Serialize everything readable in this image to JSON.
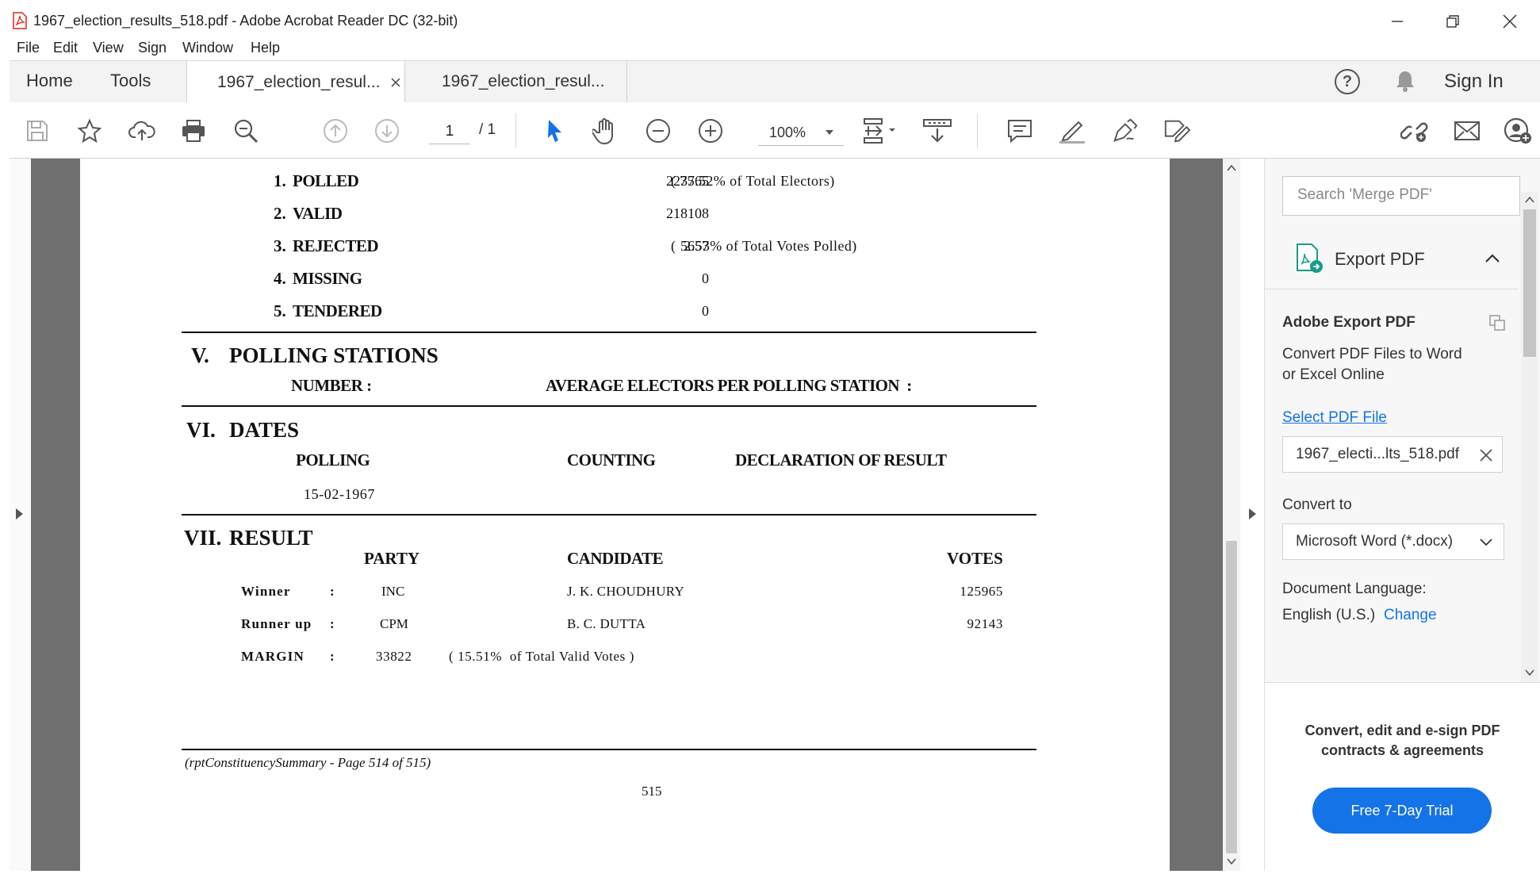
{
  "window": {
    "title": "1967_election_results_518.pdf - Adobe Acrobat Reader DC (32-bit)"
  },
  "menu": [
    "File",
    "Edit",
    "View",
    "Sign",
    "Window",
    "Help"
  ],
  "tabs": {
    "home": "Home",
    "tools": "Tools",
    "doc_tab_1": "1967_election_resul...",
    "doc_tab_2": "1967_election_resul...",
    "sign_in": "Sign In"
  },
  "toolbar": {
    "page_current": "1",
    "page_total": "/ 1",
    "zoom": "100%"
  },
  "document": {
    "turnout": [
      {
        "num": "1.",
        "label": "POLLED",
        "value": "223765",
        "note": "( 75.52% of Total Electors)"
      },
      {
        "num": "2.",
        "label": "VALID",
        "value": "218108",
        "note": ""
      },
      {
        "num": "3.",
        "label": "REJECTED",
        "value": "5657",
        "note": "(  2.53% of Total Votes Polled)"
      },
      {
        "num": "4.",
        "label": "MISSING",
        "value": "0",
        "note": ""
      },
      {
        "num": "5.",
        "label": "TENDERED",
        "value": "0",
        "note": ""
      }
    ],
    "section5": {
      "num": "V.",
      "title": "POLLING STATIONS",
      "number_label": "NUMBER :",
      "average_label": "AVERAGE ELECTORS PER POLLING STATION  :"
    },
    "section6": {
      "num": "VI.",
      "title": "DATES",
      "polling_label": "POLLING",
      "counting_label": "COUNTING",
      "declaration_label": "DECLARATION OF RESULT",
      "polling_date": "15-02-1967"
    },
    "section7": {
      "num": "VII.",
      "title": "RESULT",
      "party_header": "PARTY",
      "candidate_header": "CANDIDATE",
      "votes_header": "VOTES",
      "rows": [
        {
          "label": "Winner",
          "colon": ":",
          "party": "INC",
          "candidate": "J. K. CHOUDHURY",
          "votes": "125965"
        },
        {
          "label": "Runner up",
          "colon": ":",
          "party": "CPM",
          "candidate": "B. C. DUTTA",
          "votes": "92143"
        }
      ],
      "margin_label": "MARGIN",
      "margin_colon": ":",
      "margin_value": "33822",
      "margin_note": "( 15.51%  of Total Valid Votes )"
    },
    "footer_text": "(rptConstituencySummary - Page 514 of  515)",
    "page_number": "515"
  },
  "right_panel": {
    "search_placeholder": "Search 'Merge PDF'",
    "export_title": "Export PDF",
    "adobe_export_heading": "Adobe Export PDF",
    "description_line1": "Convert PDF Files to Word",
    "description_line2": "or Excel Online",
    "select_file_link": "Select PDF File",
    "selected_file": "1967_electi...lts_518.pdf",
    "convert_to_label": "Convert to",
    "convert_format": "Microsoft Word (*.docx)",
    "doc_language_label": "Document Language:",
    "doc_language_value": "English (U.S.)",
    "change_link": "Change",
    "promo_line1": "Convert, edit and e-sign PDF",
    "promo_line2": "contracts & agreements",
    "trial_button": "Free 7-Day Trial"
  },
  "colors": {
    "accent": "#1473e6",
    "link": "#1473e6",
    "pdf_red": "#e0261e",
    "doc_gray": "#6f6f6f"
  }
}
